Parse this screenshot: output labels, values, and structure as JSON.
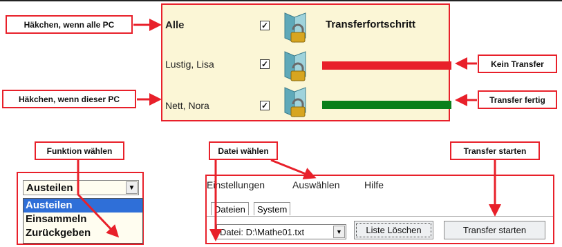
{
  "callouts": {
    "all_pc": "Häkchen, wenn alle PC",
    "this_pc": "Häkchen, wenn dieser PC",
    "no_transfer": "Kein Transfer",
    "transfer_done": "Transfer fertig",
    "choose_function": "Funktion wählen",
    "choose_file": "Datei wählen",
    "start_transfer": "Transfer starten"
  },
  "panel": {
    "header": "Transferfortschritt",
    "rows": [
      {
        "name": "Alle",
        "checked": "☑",
        "bold": true
      },
      {
        "name": "Lustig, Lisa",
        "checked": "☑",
        "status": "none"
      },
      {
        "name": "Nett, Nora",
        "checked": "☑",
        "status": "done"
      }
    ],
    "check_glyph": "✓"
  },
  "function_select": {
    "selected": "Austeilen",
    "options": [
      "Austeilen",
      "Einsammeln",
      "Zurückgeben"
    ]
  },
  "app": {
    "menu": [
      "Einstellungen",
      "Auswählen",
      "Hilfe"
    ],
    "tabs": [
      "Dateien",
      "System"
    ],
    "file_select": "Datei: D:\\Mathe01.txt",
    "clear_button": "Liste Löschen",
    "start_button": "Transfer starten"
  },
  "colors": {
    "callout_border": "#e8202a",
    "bar_none": "#e8202a",
    "bar_done": "#0a7f1a",
    "selection": "#2f6fd8"
  }
}
